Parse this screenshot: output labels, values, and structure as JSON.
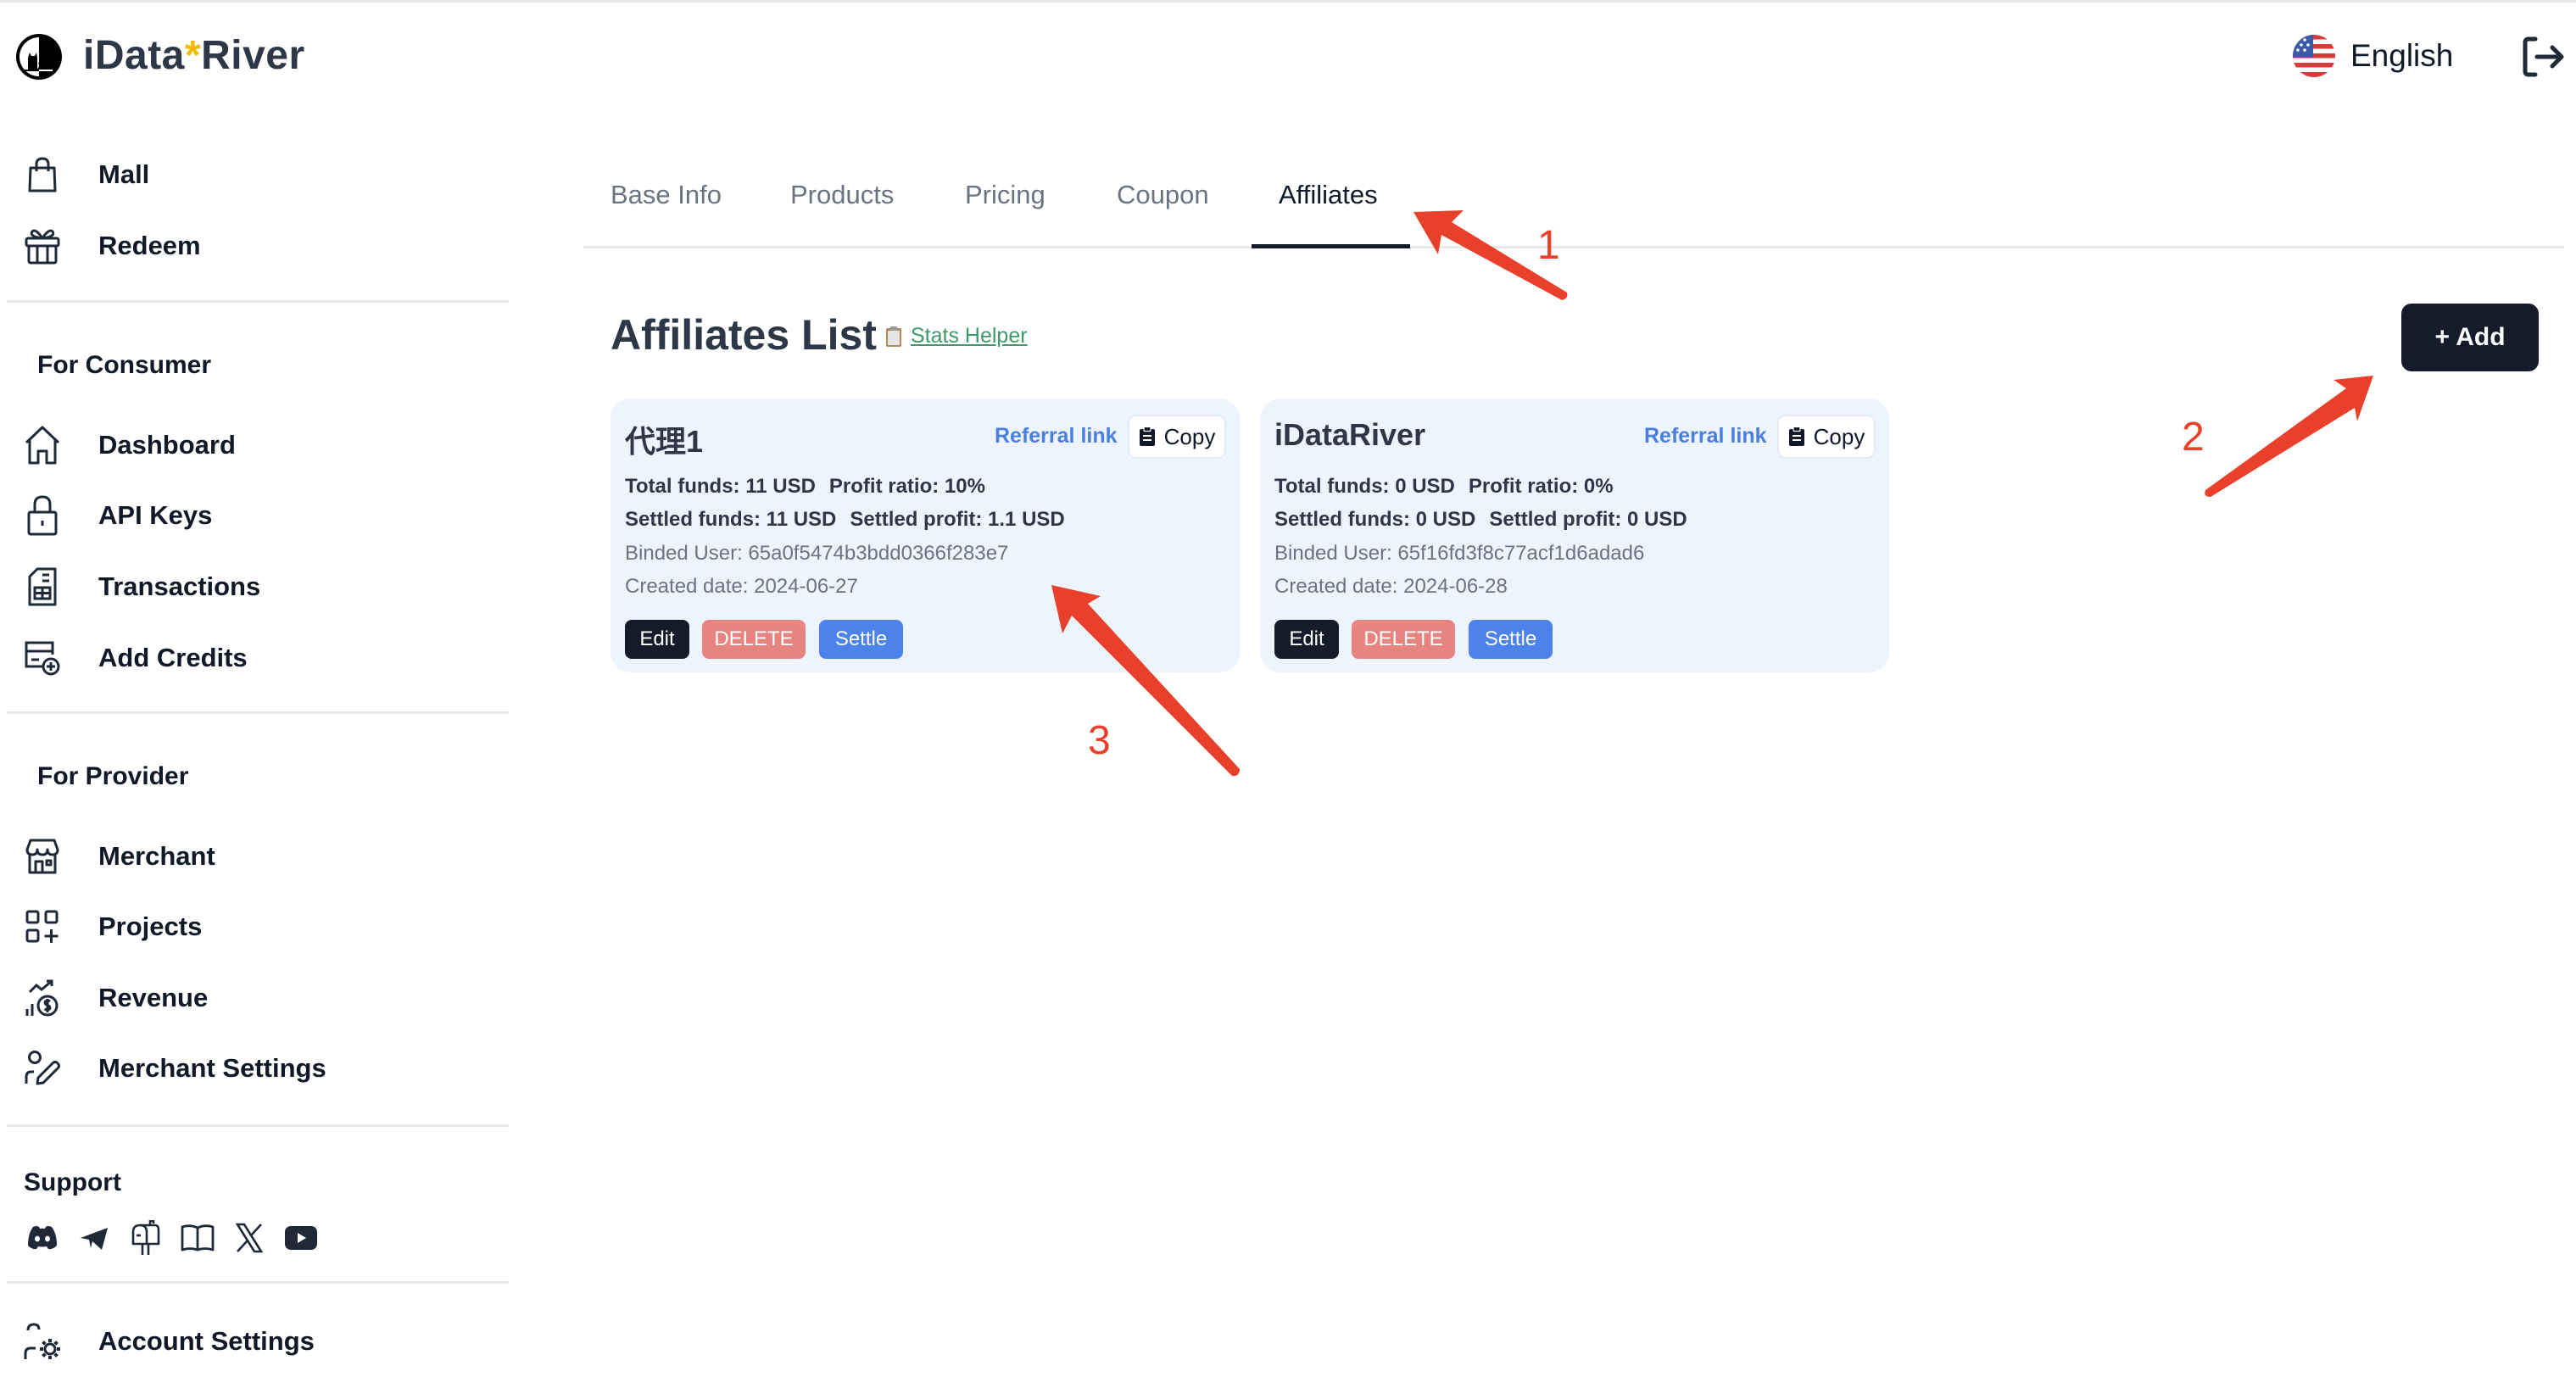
{
  "header": {
    "brand_prefix": "iData",
    "brand_star": "*",
    "brand_suffix": "River",
    "language": "English"
  },
  "sidebar": {
    "top_items": [
      {
        "label": "Mall",
        "icon": "shopping-bag-icon"
      },
      {
        "label": "Redeem",
        "icon": "gift-icon"
      }
    ],
    "consumer_title": "For Consumer",
    "consumer_items": [
      {
        "label": "Dashboard",
        "icon": "home-icon"
      },
      {
        "label": "API Keys",
        "icon": "lock-icon"
      },
      {
        "label": "Transactions",
        "icon": "receipt-icon"
      },
      {
        "label": "Add Credits",
        "icon": "card-add-icon"
      }
    ],
    "provider_title": "For Provider",
    "provider_items": [
      {
        "label": "Merchant",
        "icon": "store-icon"
      },
      {
        "label": "Projects",
        "icon": "grid-plus-icon"
      },
      {
        "label": "Revenue",
        "icon": "revenue-icon"
      },
      {
        "label": "Merchant Settings",
        "icon": "user-edit-icon"
      }
    ],
    "support_title": "Support",
    "support_icons": [
      "discord-icon",
      "telegram-icon",
      "mailbox-icon",
      "book-icon",
      "x-icon",
      "youtube-icon"
    ],
    "account_settings": "Account Settings"
  },
  "tabs": [
    {
      "label": "Base Info",
      "active": false
    },
    {
      "label": "Products",
      "active": false
    },
    {
      "label": "Pricing",
      "active": false
    },
    {
      "label": "Coupon",
      "active": false
    },
    {
      "label": "Affiliates",
      "active": true
    }
  ],
  "main": {
    "title": "Affiliates List",
    "stats_helper": "Stats Helper",
    "add_button": "+ Add",
    "affiliates": [
      {
        "name": "代理1",
        "referral_link": "Referral link",
        "copy": "Copy",
        "total_funds": "Total funds: 11 USD",
        "profit_ratio": "Profit ratio: 10%",
        "settled_funds": "Settled funds: 11 USD",
        "settled_profit": "Settled profit: 1.1 USD",
        "binded_user": "Binded User: 65a0f5474b3bdd0366f283e7",
        "created_date": "Created date: 2024-06-27",
        "edit": "Edit",
        "delete": "DELETE",
        "settle": "Settle"
      },
      {
        "name": "iDataRiver",
        "referral_link": "Referral link",
        "copy": "Copy",
        "total_funds": "Total funds: 0 USD",
        "profit_ratio": "Profit ratio: 0%",
        "settled_funds": "Settled funds: 0 USD",
        "settled_profit": "Settled profit: 0 USD",
        "binded_user": "Binded User: 65f16fd3f8c77acf1d6adad6",
        "created_date": "Created date: 2024-06-28",
        "edit": "Edit",
        "delete": "DELETE",
        "settle": "Settle"
      }
    ]
  },
  "annotations": {
    "numbers": [
      "1",
      "2",
      "3"
    ],
    "color": "#e8402a"
  },
  "colors": {
    "primary_dark": "#151b2a",
    "delete": "#e8847f",
    "settle": "#4c82ea",
    "card_bg": "#edf4fe",
    "link_blue": "#4a7fe0",
    "stats_green": "#3d9a6a",
    "brand_star": "#f5b800"
  }
}
